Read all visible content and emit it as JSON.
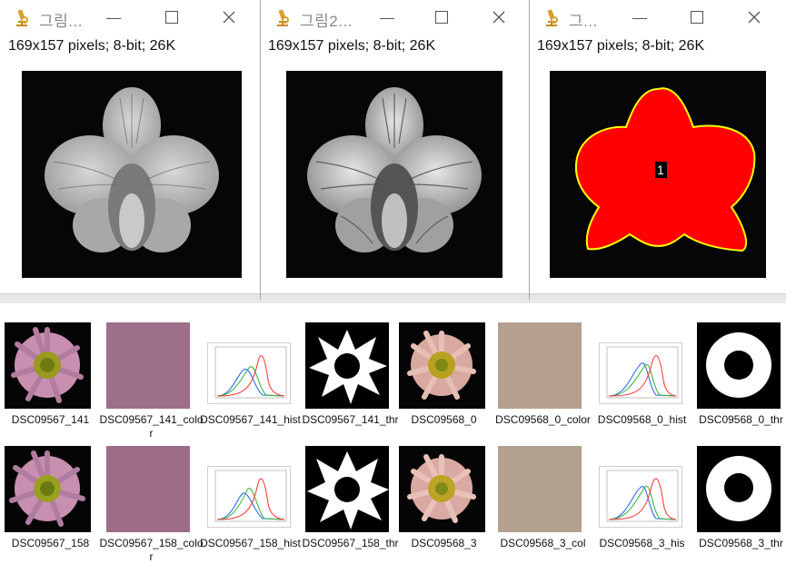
{
  "windows": [
    {
      "title": "그림...",
      "info": "169x157 pixels; 8-bit; 26K"
    },
    {
      "title": "그림2...",
      "info": "169x157 pixels; 8-bit; 26K"
    },
    {
      "title": "그...",
      "info": "169x157 pixels; 8-bit; 26K",
      "roi_label": "1"
    }
  ],
  "controls": {
    "minimize": "minimize",
    "maximize": "maximize",
    "close": "close"
  },
  "files_row1": [
    {
      "name": "DSC09567_141",
      "kind": "flower-pink"
    },
    {
      "name": "DSC09567_141_color",
      "kind": "swatch",
      "color": "#9e6f88"
    },
    {
      "name": "DSC09567_141_hist",
      "kind": "hist"
    },
    {
      "name": "DSC09567_141_thr",
      "kind": "threshold"
    },
    {
      "name": "DSC09568_0",
      "kind": "flower-peach"
    },
    {
      "name": "DSC09568_0_color",
      "kind": "swatch",
      "color": "#b5a090"
    },
    {
      "name": "DSC09568_0_hist",
      "kind": "hist"
    },
    {
      "name": "DSC09568_0_thr",
      "kind": "threshold2"
    }
  ],
  "files_row2": [
    {
      "name": "DSC09567_158",
      "kind": "flower-pink"
    },
    {
      "name": "DSC09567_158_color",
      "kind": "swatch",
      "color": "#9d6d86"
    },
    {
      "name": "DSC09567_158_hist",
      "kind": "hist"
    },
    {
      "name": "DSC09567_158_thr",
      "kind": "threshold"
    },
    {
      "name": "DSC09568_3",
      "kind": "flower-peach"
    },
    {
      "name": "DSC09568_3_col",
      "kind": "swatch",
      "color": "#b4a08f"
    },
    {
      "name": "DSC09568_3_his",
      "kind": "hist"
    },
    {
      "name": "DSC09568_3_thr",
      "kind": "threshold2"
    }
  ],
  "colors": {
    "roi_fill": "#ff0000",
    "roi_outline": "#ffff00",
    "icon_brass": "#d8a12b"
  }
}
